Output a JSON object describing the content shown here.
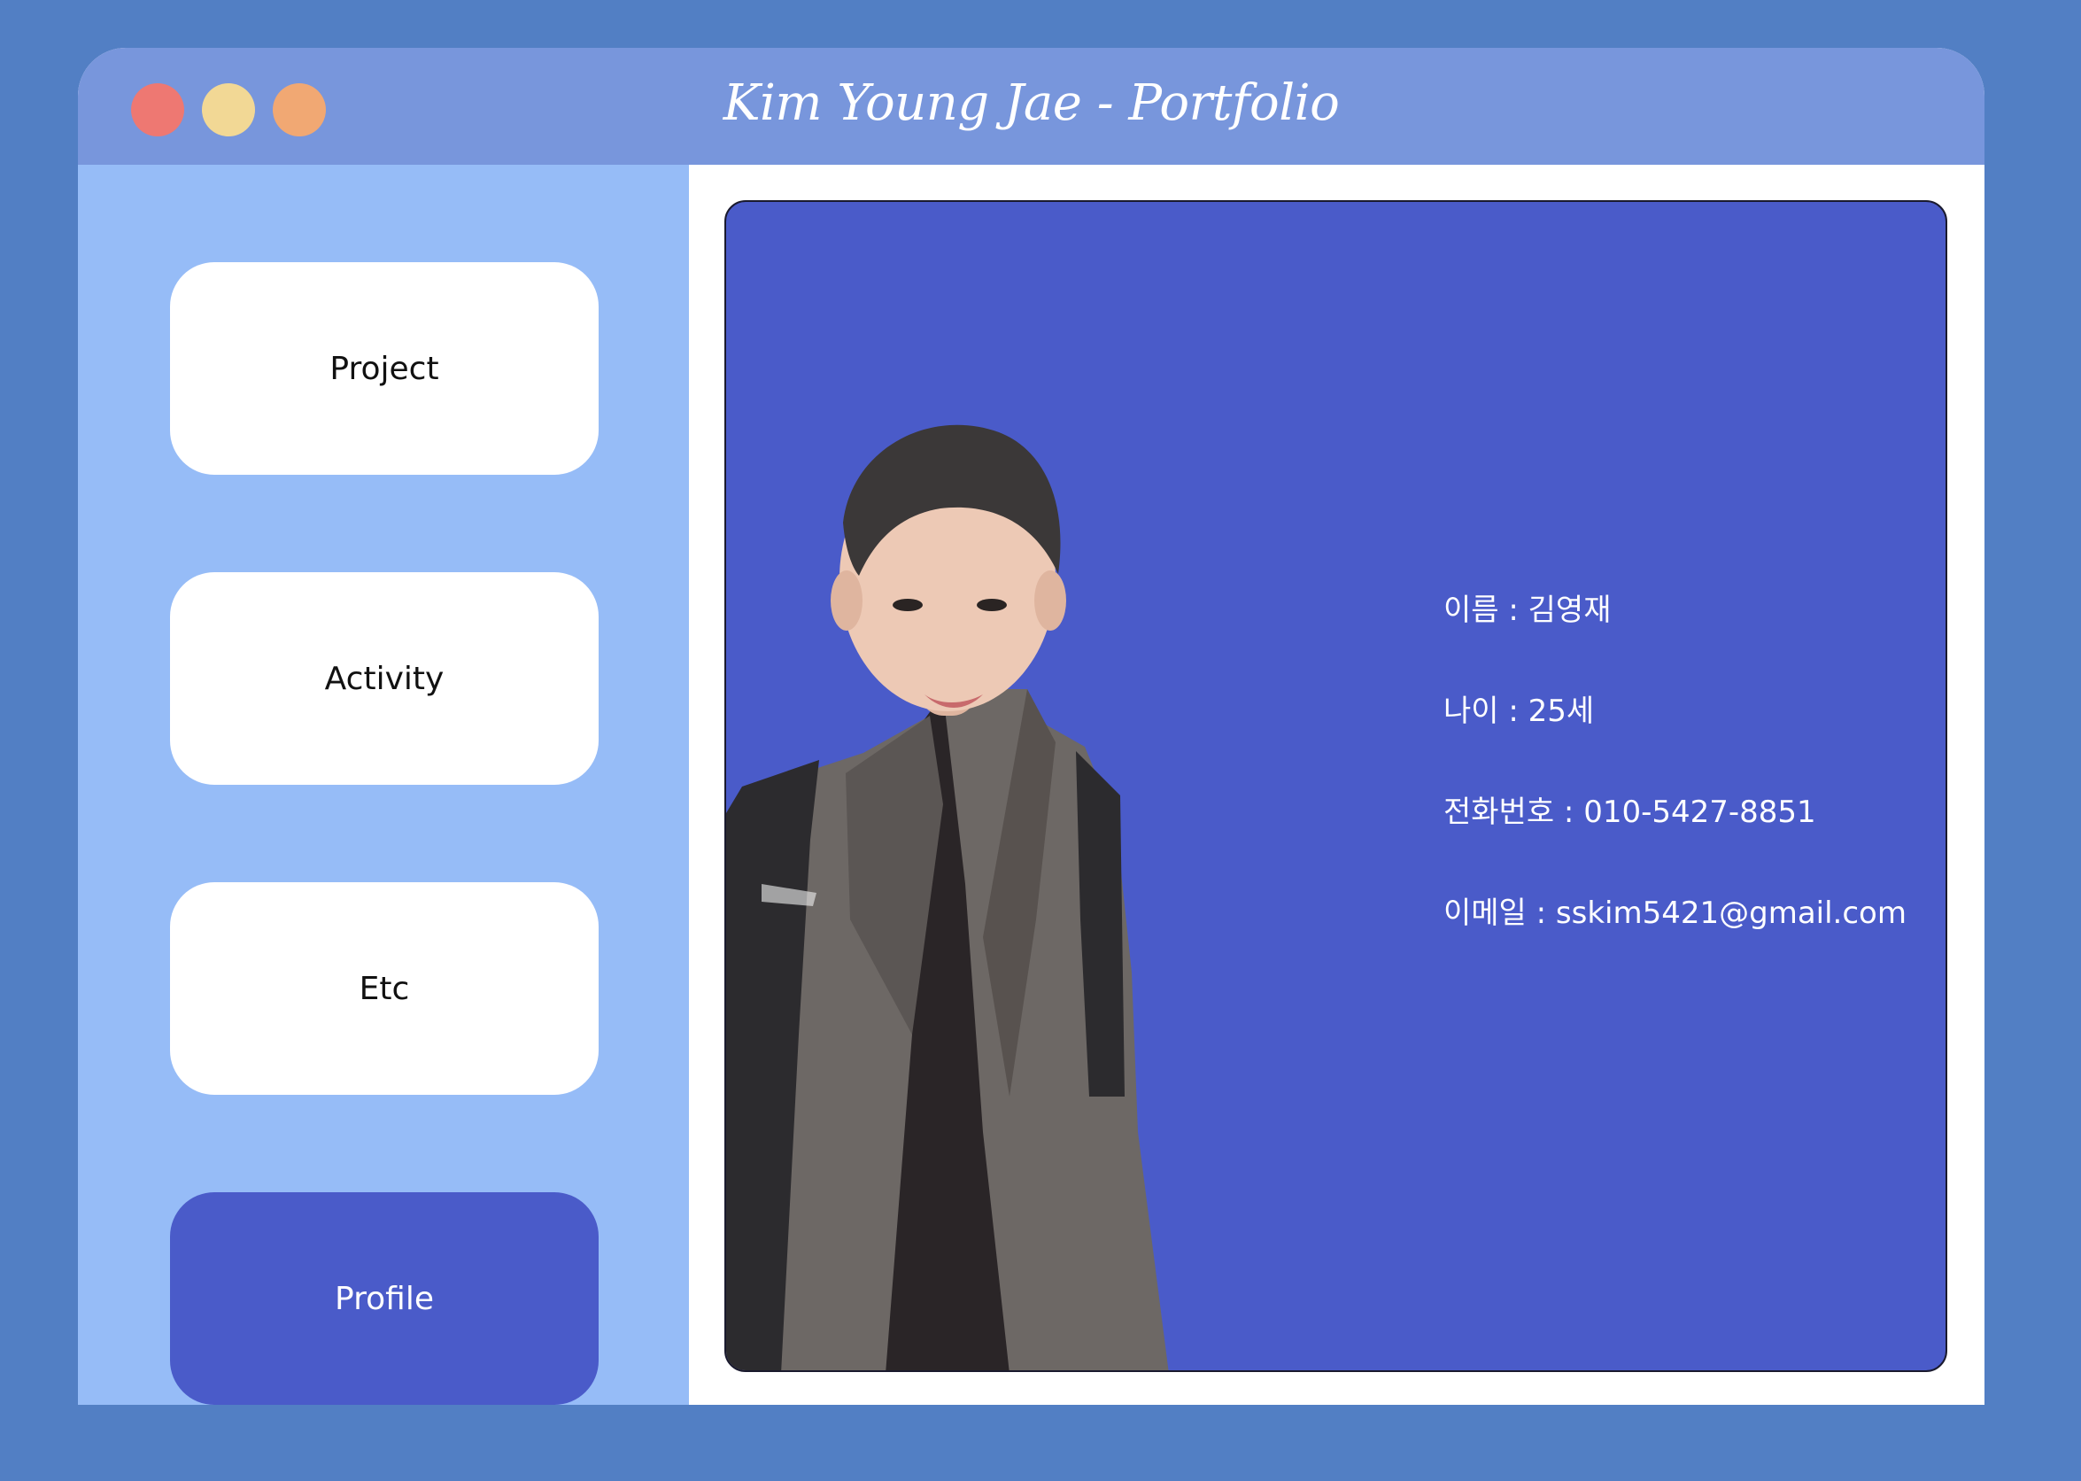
{
  "window": {
    "title": "Kim Young Jae - Portfolio",
    "controls": [
      "close",
      "minimize",
      "maximize"
    ]
  },
  "sidebar": {
    "items": [
      {
        "label": "Project",
        "active": false
      },
      {
        "label": "Activity",
        "active": false
      },
      {
        "label": "Etc",
        "active": false
      },
      {
        "label": "Profile",
        "active": true
      }
    ]
  },
  "profile": {
    "name_line": "이름 : 김영재",
    "age_line": "나이 : 25세",
    "phone_line": "전화번호 : 010-5427-8851",
    "email_line": "이메일 : sskim5421@gmail.com"
  },
  "colors": {
    "page_bg": "#527fc4",
    "titlebar": "#7896dc",
    "sidebar": "#96bcf7",
    "accent": "#4a5bc9",
    "dot_red": "#ee7872",
    "dot_yellow": "#f2d895",
    "dot_orange": "#f1a873"
  }
}
